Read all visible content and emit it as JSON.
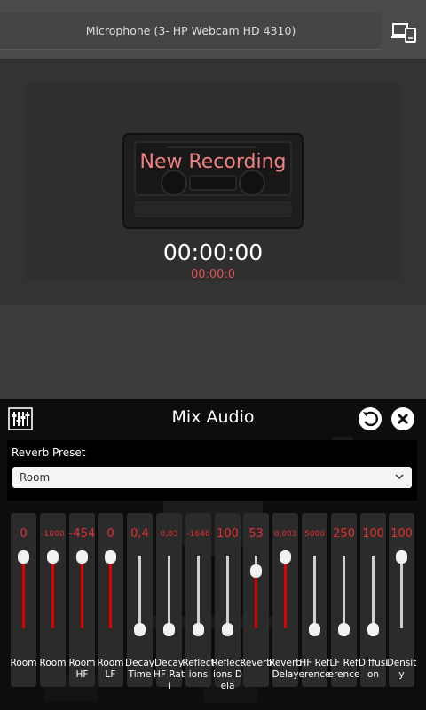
{
  "topbar": {
    "input_device": "Microphone (3- HP Webcam HD 4310)"
  },
  "recorder": {
    "title": "New Recording",
    "time": "00:00:00",
    "sub_time": "00:00:0"
  },
  "panel": {
    "title": "Mix Audio",
    "preset_label": "Reverb Preset",
    "preset_value": "Room"
  },
  "sliders": [
    {
      "label": "Room",
      "value": "0",
      "level": 1.0,
      "mode": "top"
    },
    {
      "label": "Room",
      "value": "-1000",
      "level": 1.0,
      "mode": "top",
      "small": true
    },
    {
      "label": "Room HF",
      "value": "-454",
      "level": 1.0,
      "mode": "top"
    },
    {
      "label": "Room LF",
      "value": "0",
      "level": 1.0,
      "mode": "top"
    },
    {
      "label": "Decay Time",
      "value": "0,4",
      "level": 0.0,
      "mode": "bottom"
    },
    {
      "label": "Decay HF Rati",
      "value": "0,83",
      "level": 0.0,
      "mode": "bottom",
      "small": true
    },
    {
      "label": "Reflections",
      "value": "-1646",
      "level": 0.0,
      "mode": "bottom",
      "small": true
    },
    {
      "label": "Reflections Dela",
      "value": "100",
      "level": 0.0,
      "mode": "bottom"
    },
    {
      "label": "Reverb",
      "value": "53",
      "level": 0.8,
      "mode": "fill"
    },
    {
      "label": "Reverb Delay",
      "value": "0,003",
      "level": 1.0,
      "mode": "top",
      "small": true
    },
    {
      "label": "HF Reference",
      "value": "5000",
      "level": 0.0,
      "mode": "bottom",
      "small": true
    },
    {
      "label": "LF Reference",
      "value": "250",
      "level": 0.0,
      "mode": "bottom"
    },
    {
      "label": "Diffusion",
      "value": "100",
      "level": 0.0,
      "mode": "bottom"
    },
    {
      "label": "Density",
      "value": "100",
      "level": 1.0,
      "mode": "topgray"
    }
  ],
  "colors": {
    "accent_red": "#e03030",
    "title_pink": "#f08080",
    "panel_bg": "#0d0d0d"
  }
}
